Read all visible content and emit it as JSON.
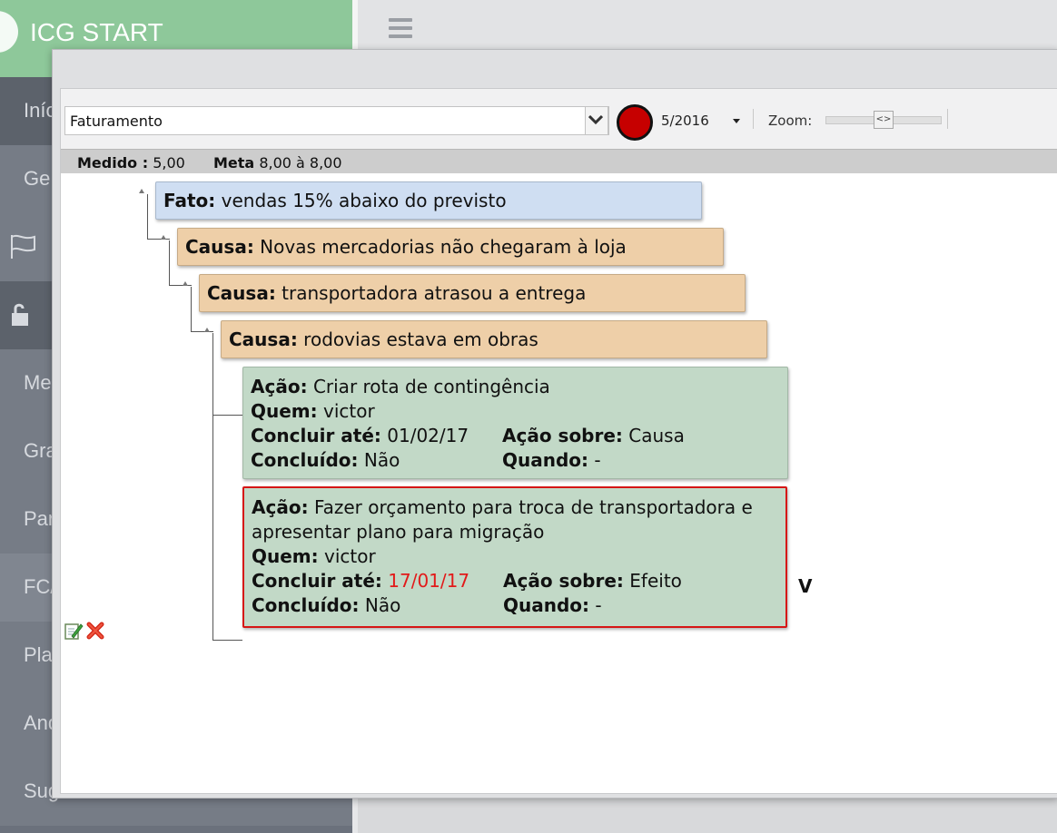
{
  "app": {
    "brand": "ICG START"
  },
  "sidebar": {
    "items": [
      {
        "label": "Iníc"
      },
      {
        "label": "Ge"
      },
      {
        "label": ""
      },
      {
        "label": ""
      },
      {
        "label": "Me"
      },
      {
        "label": "Gra"
      },
      {
        "label": "Par"
      },
      {
        "label": "FC/"
      },
      {
        "label": "Pla"
      },
      {
        "label": "And"
      },
      {
        "label": "Sugestões de ICs"
      }
    ]
  },
  "toolbar": {
    "indicator": "Faturamento",
    "period": "5/2016",
    "zoom_label": "Zoom:",
    "zoom_value": 0.5,
    "status_color": "#c60000"
  },
  "info": {
    "medido_label": "Medido :",
    "medido_value": "5,00",
    "meta_label": "Meta",
    "meta_value": "8,00 à 8,00"
  },
  "tree": {
    "fato": {
      "label": "Fato:",
      "text": "vendas 15% abaixo do previsto"
    },
    "causas": [
      {
        "label": "Causa:",
        "text": "Novas mercadorias não chegaram à loja"
      },
      {
        "label": "Causa:",
        "text": "transportadora atrasou a entrega"
      },
      {
        "label": "Causa:",
        "text": "rodovias estava em obras"
      }
    ],
    "acoes": [
      {
        "acao_label": "Ação:",
        "acao": "Criar rota de contingência",
        "quem_label": "Quem:",
        "quem": "victor",
        "concluir_label": "Concluir até:",
        "concluir": "01/02/17",
        "sobre_label": "Ação sobre:",
        "sobre": "Causa",
        "concluido_label": "Concluído:",
        "concluido": "Não",
        "quando_label": "Quando:",
        "quando": "-"
      },
      {
        "acao_label": "Ação:",
        "acao": "Fazer orçamento para troca de transportadora e apresentar plano para migração",
        "quem_label": "Quem:",
        "quem": "victor",
        "concluir_label": "Concluir até:",
        "concluir": "17/01/17",
        "sobre_label": "Ação sobre:",
        "sobre": "Efeito",
        "concluido_label": "Concluído:",
        "concluido": "Não",
        "quando_label": "Quando:",
        "quando": "-"
      }
    ],
    "selected_mark": "V"
  },
  "colors": {
    "overdue": "#e21a1a",
    "selected_border": "#d61515"
  }
}
